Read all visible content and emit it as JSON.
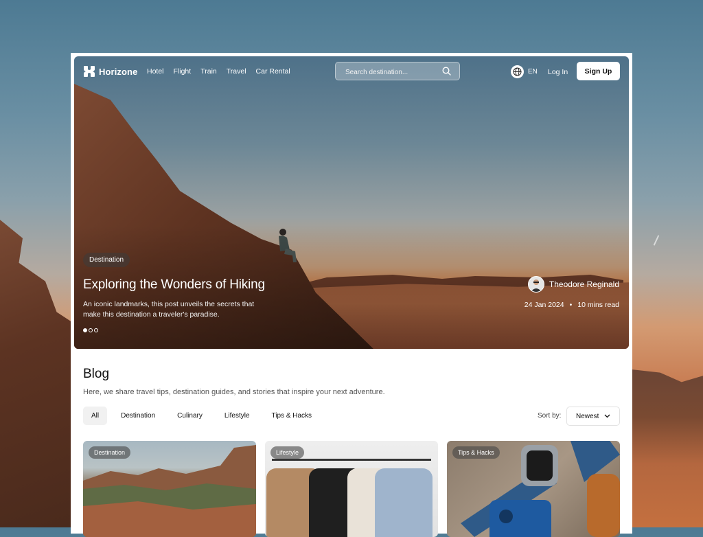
{
  "brand": {
    "name": "Horizone"
  },
  "nav": {
    "links": [
      "Hotel",
      "Flight",
      "Train",
      "Travel",
      "Car Rental"
    ],
    "search_placeholder": "Search destination...",
    "language": "EN",
    "login_label": "Log In",
    "signup_label": "Sign Up"
  },
  "hero": {
    "badge": "Destination",
    "title": "Exploring the Wonders of Hiking",
    "description": "An iconic landmarks, this post unveils the secrets that make this destination a traveler's paradise.",
    "author": "Theodore Reginald",
    "date": "24 Jan 2024",
    "separator": "•",
    "read_time": "10 mins read",
    "slides_total": 3,
    "slide_active": 1
  },
  "blog": {
    "title": "Blog",
    "subtitle": "Here, we share travel tips, destination guides, and stories that inspire your next adventure.",
    "filters": [
      "All",
      "Destination",
      "Culinary",
      "Lifestyle",
      "Tips & Hacks"
    ],
    "active_filter": "All",
    "sort_label": "Sort by:",
    "sort_value": "Newest",
    "cards": [
      {
        "badge": "Destination"
      },
      {
        "badge": "Lifestyle"
      },
      {
        "badge": "Tips & Hacks"
      }
    ]
  },
  "colors": {
    "white": "#ffffff",
    "text_dark": "#111111",
    "text_muted": "#555555",
    "chip_active_bg": "#f1f1f1"
  },
  "icons": [
    "logo-icon",
    "search-icon",
    "globe-icon",
    "chevron-down-icon"
  ]
}
